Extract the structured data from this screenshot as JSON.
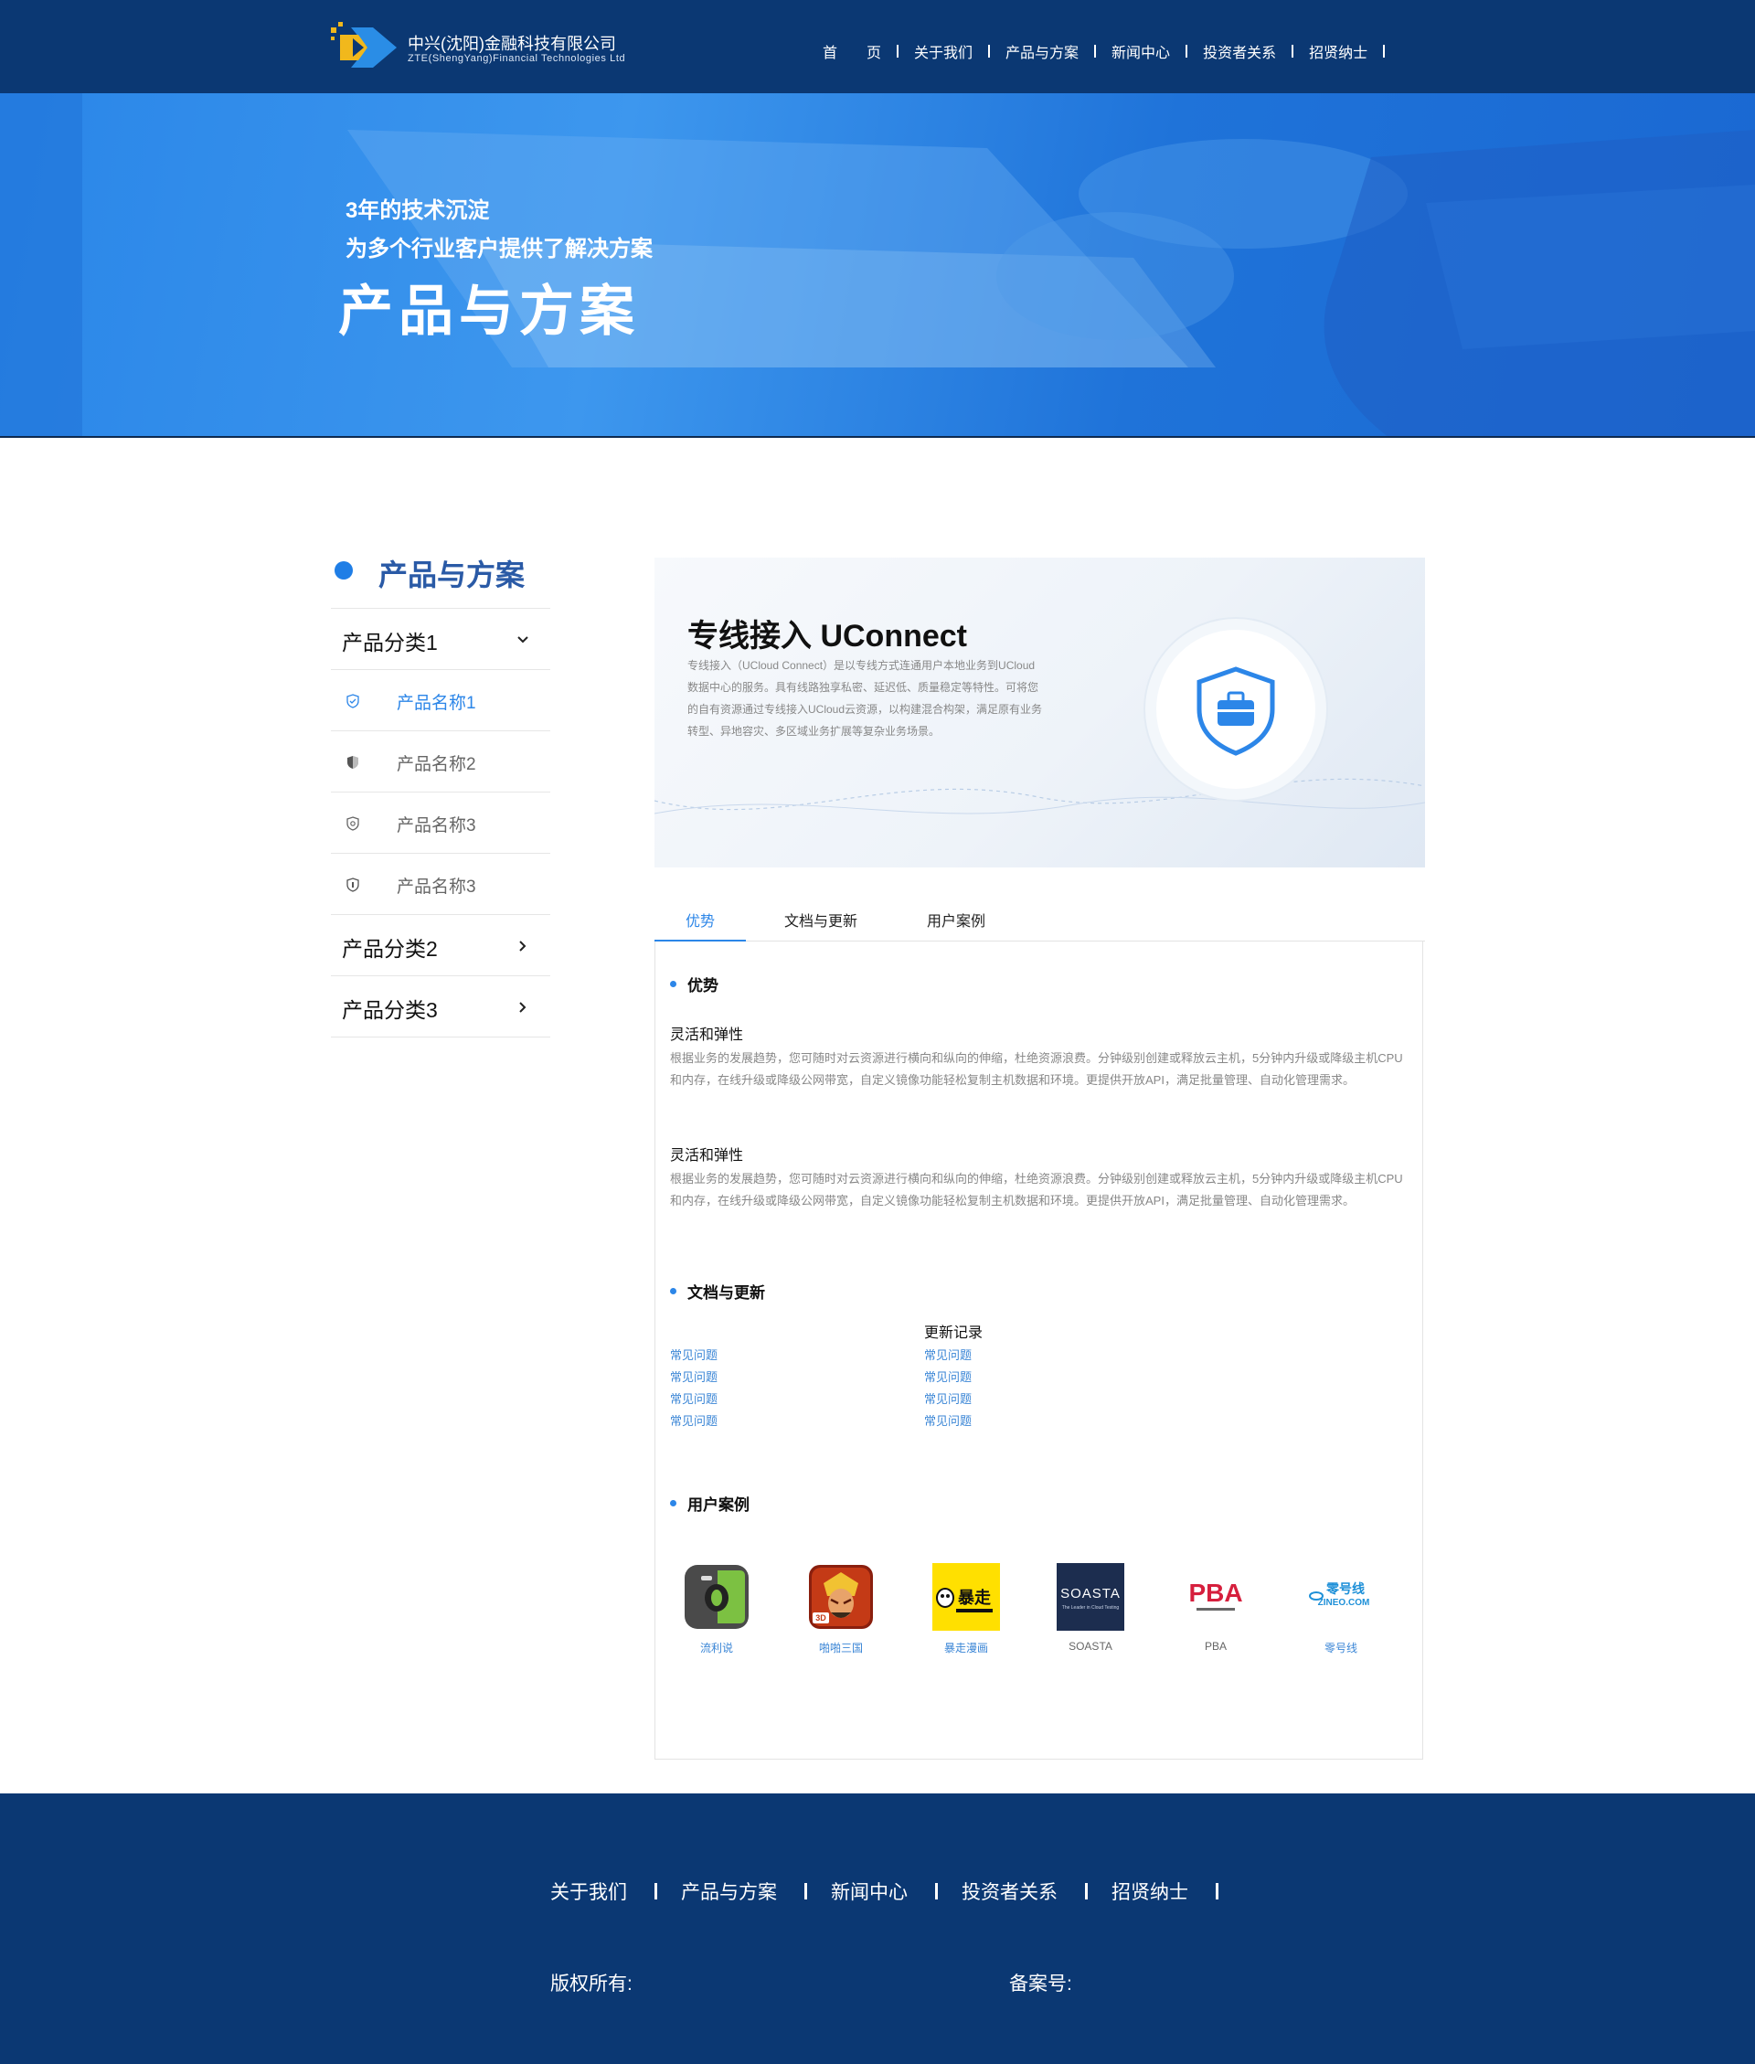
{
  "header": {
    "company_cn": "中兴(沈阳)金融科技有限公司",
    "company_en": "ZTE(ShengYang)Financial Technologies Ltd",
    "nav": [
      "首　　页",
      "关于我们",
      "产品与方案",
      "新闻中心",
      "投资者关系",
      "招贤纳士"
    ]
  },
  "banner": {
    "line1": "3年的技术沉淀",
    "line2": "为多个行业客户提供了解决方案",
    "title": "产品与方案"
  },
  "sidebar": {
    "title": "产品与方案",
    "categories": [
      {
        "label": "产品分类1",
        "expanded": true,
        "items": [
          {
            "label": "产品名称1",
            "active": true,
            "icon": "shield-check-icon"
          },
          {
            "label": "产品名称2",
            "active": false,
            "icon": "shield-half-icon"
          },
          {
            "label": "产品名称3",
            "active": false,
            "icon": "shield-outline-icon"
          },
          {
            "label": "产品名称3",
            "active": false,
            "icon": "shield-dot-icon"
          }
        ]
      },
      {
        "label": "产品分类2",
        "expanded": false
      },
      {
        "label": "产品分类3",
        "expanded": false
      }
    ]
  },
  "product": {
    "title": "专线接入 UConnect",
    "description": "专线接入（UCloud Connect）是以专线方式连通用户本地业务到UCloud数据中心的服务。具有线路独享私密、延迟低、质量稳定等特性。可将您的自有资源通过专线接入UCloud云资源，以构建混合构架，满足原有业务转型、异地容灾、多区域业务扩展等复杂业务场景。",
    "icon": "shield-briefcase-icon"
  },
  "tabs": [
    "优势",
    "文档与更新",
    "用户案例"
  ],
  "active_tab": "优势",
  "advantages": {
    "heading": "优势",
    "features": [
      {
        "title": "灵活和弹性",
        "desc": "根据业务的发展趋势，您可随时对云资源进行横向和纵向的伸缩，杜绝资源浪费。分钟级别创建或释放云主机，5分钟内升级或降级主机CPU和内存，在线升级或降级公网带宽，自定义镜像功能轻松复制主机数据和环境。更提供开放API，满足批量管理、自动化管理需求。"
      },
      {
        "title": "灵活和弹性",
        "desc": "根据业务的发展趋势，您可随时对云资源进行横向和纵向的伸缩，杜绝资源浪费。分钟级别创建或释放云主机，5分钟内升级或降级主机CPU和内存，在线升级或降级公网带宽，自定义镜像功能轻松复制主机数据和环境。更提供开放API，满足批量管理、自动化管理需求。"
      }
    ]
  },
  "docs": {
    "heading": "文档与更新",
    "left_links": [
      "常见问题",
      "常见问题",
      "常见问题",
      "常见问题"
    ],
    "right_heading": "更新记录",
    "right_links": [
      "常见问题",
      "常见问题",
      "常见问题",
      "常见问题"
    ]
  },
  "cases": {
    "heading": "用户案例",
    "items": [
      {
        "name": "流利说",
        "logo": "liulishuo-logo"
      },
      {
        "name": "啪啪三国",
        "logo": "papa-sanguo-logo"
      },
      {
        "name": "暴走漫画",
        "logo": "baozou-manhua-logo"
      },
      {
        "name": "SOASTA",
        "logo": "soasta-logo"
      },
      {
        "name": "PBA",
        "logo": "pba-logo"
      },
      {
        "name": "零号线",
        "logo": "zero-line-logo"
      }
    ],
    "logo_text": {
      "soasta": "SOASTA",
      "soasta_tag": "The Leader in Cloud Testing",
      "pba": "PBA",
      "baozou": "暴走",
      "zeroline_cn": "零号线",
      "zeroline_en": "ZINEO.COM",
      "papa_badge": "3D"
    }
  },
  "footer": {
    "nav": [
      "关于我们",
      "产品与方案",
      "新闻中心",
      "投资者关系",
      "招贤纳士"
    ],
    "copyright": "版权所有:",
    "icp": "备案号:"
  },
  "colors": {
    "header_bg": "#0b3873",
    "accent": "#2c86e8",
    "link": "#3b86d6",
    "banner_blue": "#2a86e8"
  }
}
